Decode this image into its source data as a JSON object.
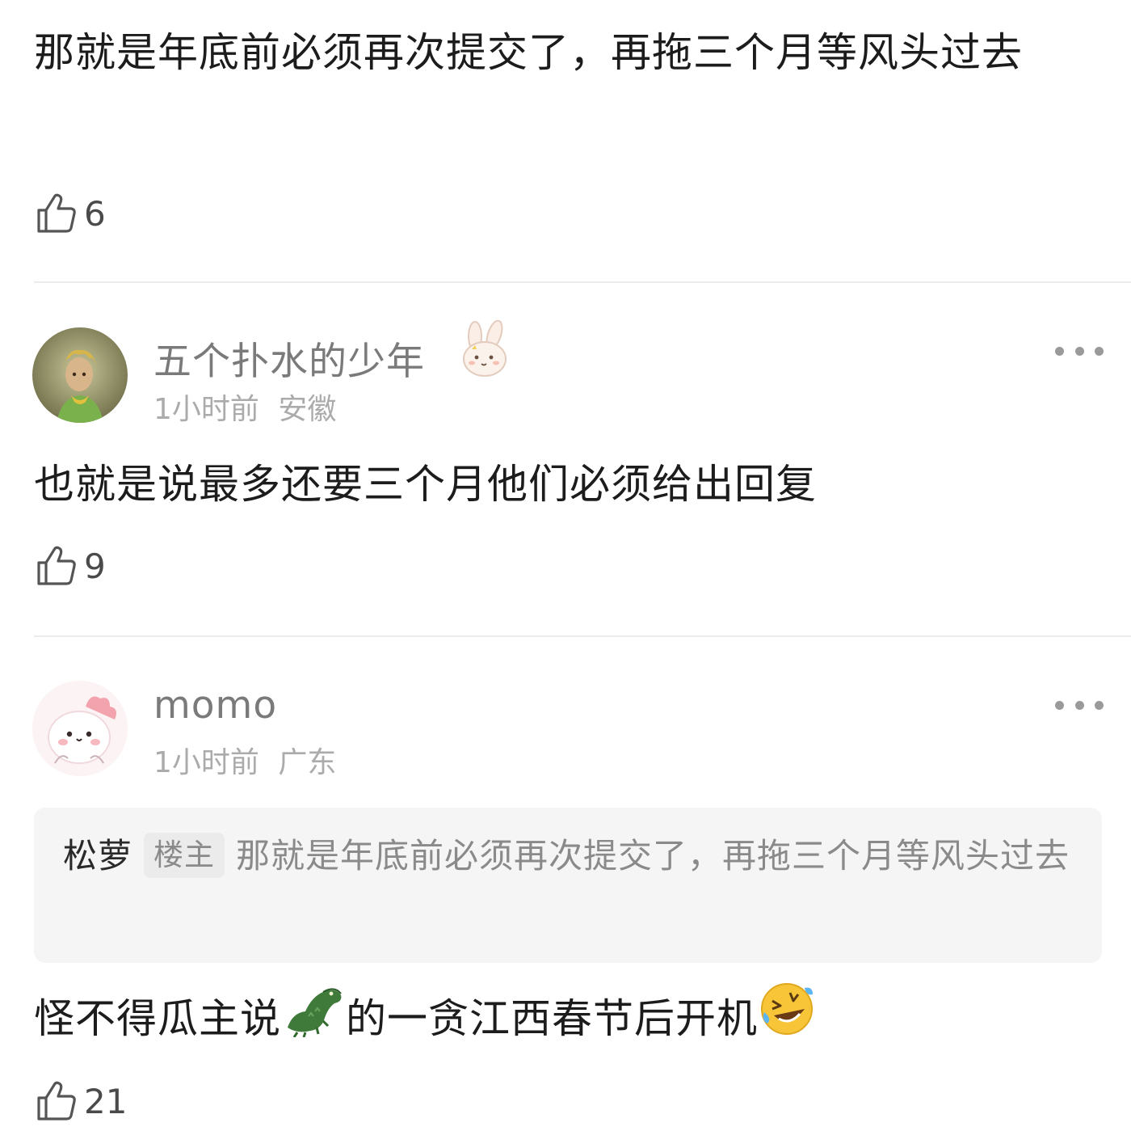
{
  "comments": [
    {
      "text": "那就是年底前必须再次提交了，再拖三个月等风头过去",
      "likes": "6"
    },
    {
      "username": "五个扑水的少年",
      "time": "1小时前",
      "location": "安徽",
      "text": "也就是说最多还要三个月他们必须给出回复",
      "likes": "9"
    },
    {
      "username": "momo",
      "time": "1小时前",
      "location": "广东",
      "quote": {
        "author": "松萝",
        "badge": "楼主",
        "text": "那就是年底前必须再次提交了，再拖三个月等风头过去"
      },
      "text_part1": "怪不得瓜主说",
      "text_part2": "的一贪江西春节后开机",
      "emoji_1": "crocodile-emoji",
      "emoji_2": "rolling-laughing-emoji",
      "likes": "21"
    }
  ]
}
